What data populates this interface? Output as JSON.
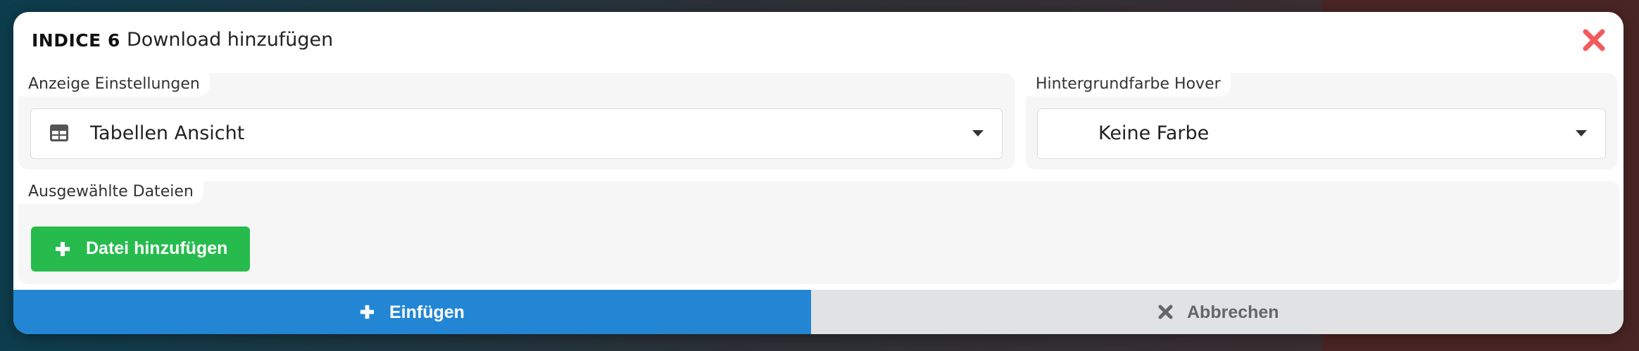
{
  "modal": {
    "brand": "INDICE 6",
    "title": "Download hinzufügen",
    "close_icon": "close-x-icon"
  },
  "display_settings": {
    "label": "Anzeige Einstellungen",
    "selected": "Tabellen Ansicht",
    "icon": "table-icon"
  },
  "hover_background": {
    "label": "Hintergrundfarbe Hover",
    "selected": "Keine Farbe"
  },
  "selected_files": {
    "label": "Ausgewählte Dateien",
    "add_button": "Datei hinzufügen",
    "add_icon": "plus-icon"
  },
  "footer": {
    "insert_label": "Einfügen",
    "cancel_label": "Abbrechen"
  },
  "colors": {
    "primary": "#2386d4",
    "success": "#27bb4d",
    "danger": "#f15b5b",
    "neutral": "#e1e2e3"
  }
}
